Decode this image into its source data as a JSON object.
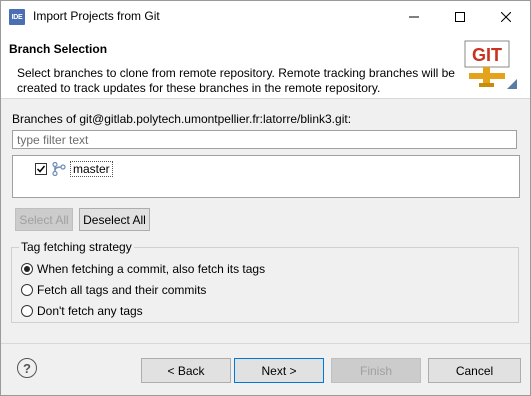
{
  "window": {
    "app_icon_text": "IDE",
    "title": "Import Projects from Git"
  },
  "banner": {
    "title": "Branch Selection",
    "description": "Select branches to clone from remote repository. Remote tracking branches will be created to track updates for these branches in the remote repository.",
    "logo_text": "GIT"
  },
  "branches": {
    "label": "Branches of git@gitlab.polytech.umontpellier.fr:latorre/blink3.git:",
    "filter_placeholder": "type filter text",
    "filter_value": "",
    "items": [
      {
        "label": "master",
        "checked": true
      }
    ]
  },
  "buttons": {
    "select_all": "Select All",
    "deselect_all": "Deselect All"
  },
  "tag_fetching": {
    "legend": "Tag fetching strategy",
    "options": [
      {
        "label": "When fetching a commit, also fetch its tags",
        "selected": true
      },
      {
        "label": "Fetch all tags and their commits",
        "selected": false
      },
      {
        "label": "Don't fetch any tags",
        "selected": false
      }
    ]
  },
  "footer": {
    "help": "?",
    "back": "< Back",
    "next": "Next >",
    "finish": "Finish",
    "cancel": "Cancel"
  },
  "colors": {
    "accent": "#0078d7",
    "window_bg": "#f0f0f0",
    "git_logo_red": "#c8321e",
    "git_logo_pipe": "#e5a31b"
  }
}
